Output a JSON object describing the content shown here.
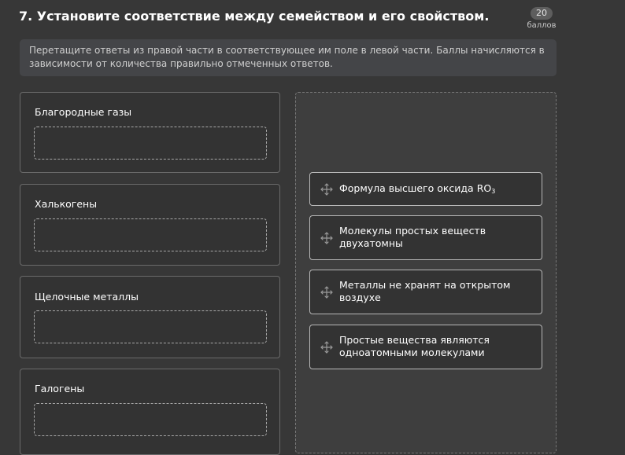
{
  "question": {
    "title": "7. Установите соответствие между семейством и его свойством.",
    "points_value": "20",
    "points_label": "баллов",
    "instruction": "Перетащите ответы из правой части в соответствующее им поле в левой части. Баллы начисляются в зависимости от количества правильно отмеченных ответов."
  },
  "categories": [
    {
      "label": "Благородные газы"
    },
    {
      "label": "Халькогены"
    },
    {
      "label": "Щелочные металлы"
    },
    {
      "label": "Галогены"
    }
  ],
  "answers": [
    {
      "label": "Формула высшего оксида RO",
      "subscript": "3"
    },
    {
      "label": "Молекулы простых веществ двухатомны"
    },
    {
      "label": "Металлы не хранят на открытом воздухе"
    },
    {
      "label": "Простые вещества являются одноатомными молекулами"
    }
  ],
  "icons": {
    "drag_handle": "move-arrows-icon"
  },
  "colors": {
    "background": "#373737",
    "instruction_background": "#444548",
    "card_border": "#6a6a6a",
    "answer_border": "#b8b8b8",
    "dropzone_border": "#a8a8a8",
    "text": "#ffffff"
  }
}
